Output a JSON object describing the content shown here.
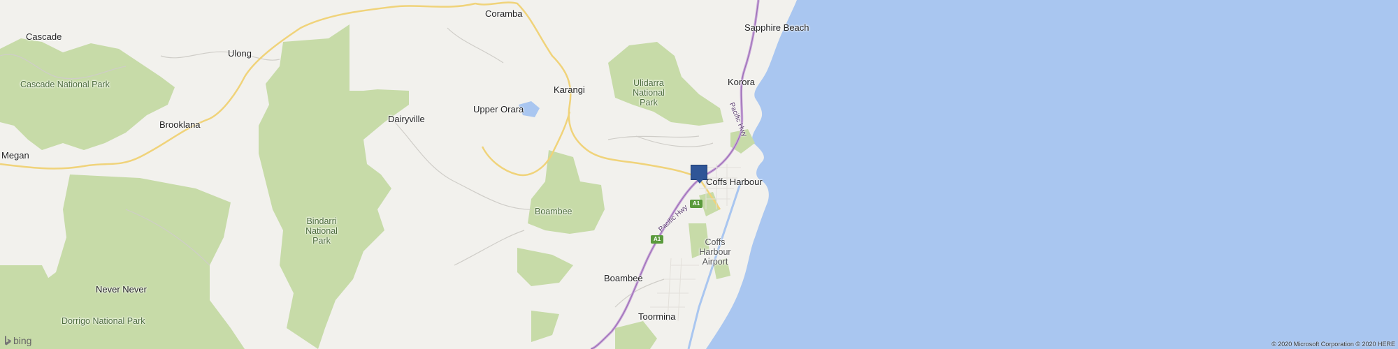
{
  "map": {
    "pin_color": "#2f5597",
    "ocean_color": "#a9c6f0",
    "park_color": "#c7dba8",
    "land_color": "#f2f1ed",
    "places": {
      "coramba": "Coramba",
      "sapphire_beach": "Sapphire Beach",
      "cascade": "Cascade",
      "ulong": "Ulong",
      "cascade_np": "Cascade National Park",
      "korora": "Korora",
      "karangi": "Karangi",
      "ulidarra_np_1": "Ulidarra",
      "ulidarra_np_2": "National",
      "ulidarra_np_3": "Park",
      "upper_orara": "Upper Orara",
      "dairyville": "Dairyville",
      "brooklana": "Brooklana",
      "megan": "Megan",
      "coffs_harbour": "Coffs Harbour",
      "boambee_forest": "Boambee",
      "bindarri_1": "Bindarri",
      "bindarri_2": "National",
      "bindarri_3": "Park",
      "airport_1": "Coffs",
      "airport_2": "Harbour",
      "airport_3": "Airport",
      "boambee": "Boambee",
      "never_never": "Never Never",
      "dorrigo_np": "Dorrigo National Park",
      "toormina": "Toormina"
    },
    "roads": {
      "shield_a1_north": "A1",
      "shield_a1_south": "A1",
      "pacific_hwy_north": "Pacific Hwy",
      "pacific_hwy_south": "Pacific Hwy"
    },
    "branding": {
      "logo": "bing",
      "copyright": "© 2020 Microsoft Corporation © 2020 HERE"
    }
  }
}
